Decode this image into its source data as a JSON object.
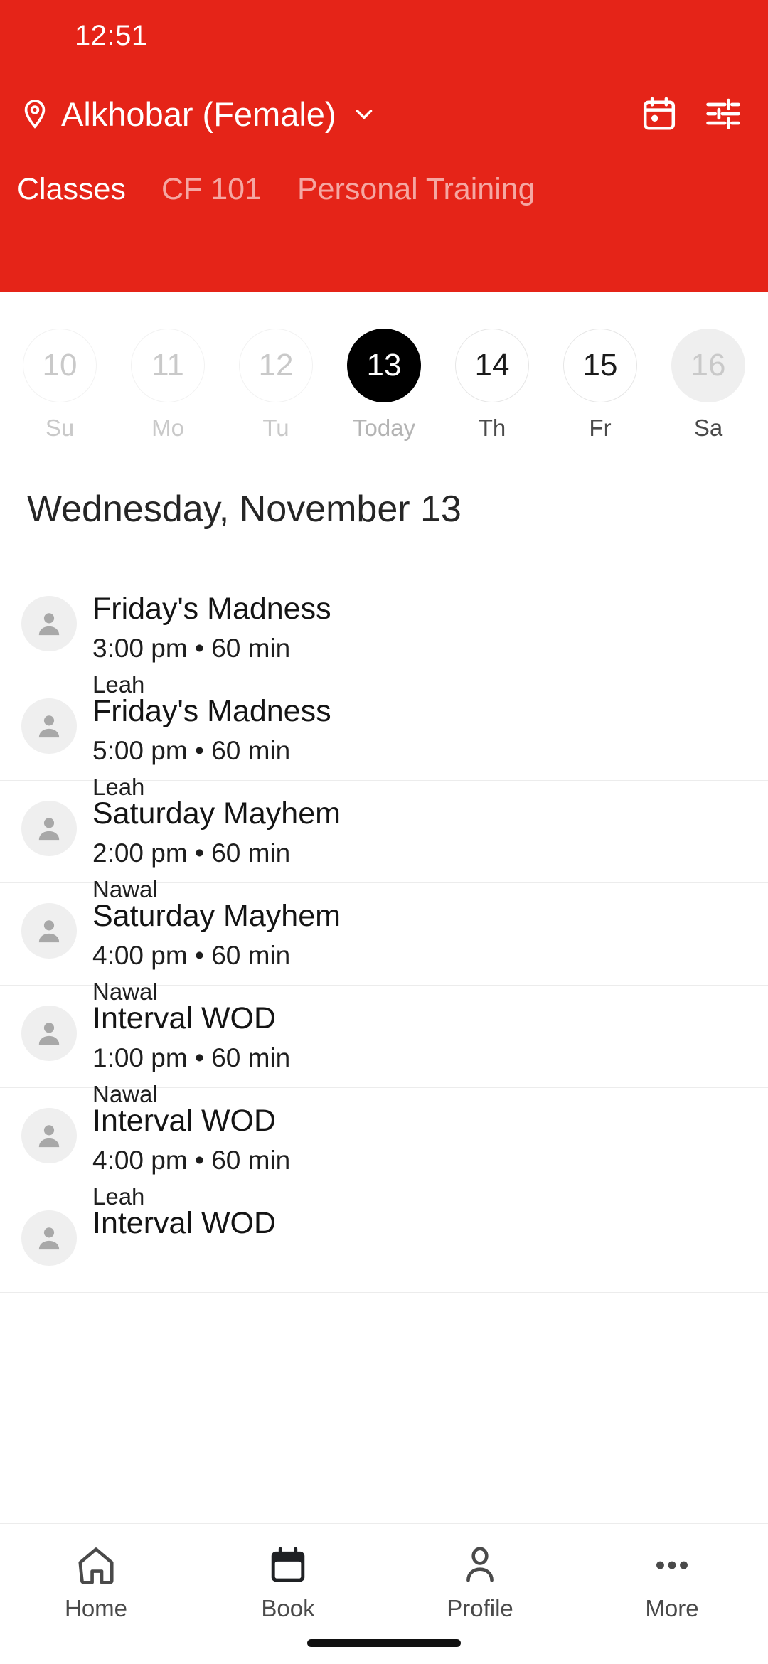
{
  "theme": {
    "brand_red": "#E52418",
    "today_bg": "#000000",
    "text_dark": "#141414",
    "muted": "#8c8c8c"
  },
  "status_bar": {
    "time": "12:51"
  },
  "header": {
    "location_name": "Alkhobar (Female)",
    "pin_icon": "location-pin-icon",
    "chevron_icon": "chevron-down-icon",
    "calendar_icon": "calendar-icon",
    "filter_icon": "filter-sliders-icon",
    "tabs": [
      {
        "label": "Classes",
        "active": true
      },
      {
        "label": "CF 101",
        "active": false
      },
      {
        "label": "Personal Training",
        "active": false
      }
    ]
  },
  "date_strip": [
    {
      "date": "10",
      "day": "Su",
      "state": "past"
    },
    {
      "date": "11",
      "day": "Mo",
      "state": "past"
    },
    {
      "date": "12",
      "day": "Tu",
      "state": "past"
    },
    {
      "date": "13",
      "day": "Today",
      "state": "today"
    },
    {
      "date": "14",
      "day": "Th",
      "state": "normal"
    },
    {
      "date": "15",
      "day": "Fr",
      "state": "normal"
    },
    {
      "date": "16",
      "day": "Sa",
      "state": "disabled"
    }
  ],
  "selected_date_heading": "Wednesday, November 13",
  "classes": [
    {
      "title": "Friday's Madness",
      "meta": "3:00 pm • 60 min",
      "coach": "Leah"
    },
    {
      "title": "Friday's Madness",
      "meta": "5:00 pm • 60 min",
      "coach": "Leah"
    },
    {
      "title": "Saturday Mayhem",
      "meta": "2:00 pm • 60 min",
      "coach": "Nawal"
    },
    {
      "title": "Saturday Mayhem",
      "meta": "4:00 pm • 60 min",
      "coach": "Nawal"
    },
    {
      "title": "Interval WOD",
      "meta": "1:00 pm • 60 min",
      "coach": "Nawal"
    },
    {
      "title": "Interval WOD",
      "meta": "4:00 pm • 60 min",
      "coach": "Leah"
    },
    {
      "title": "Interval WOD",
      "meta": "",
      "coach": ""
    }
  ],
  "bottom_nav": [
    {
      "label": "Home",
      "icon": "home-icon",
      "active": false
    },
    {
      "label": "Book",
      "icon": "calendar-icon",
      "active": true
    },
    {
      "label": "Profile",
      "icon": "person-icon",
      "active": false
    },
    {
      "label": "More",
      "icon": "more-dots-icon",
      "active": false
    }
  ]
}
